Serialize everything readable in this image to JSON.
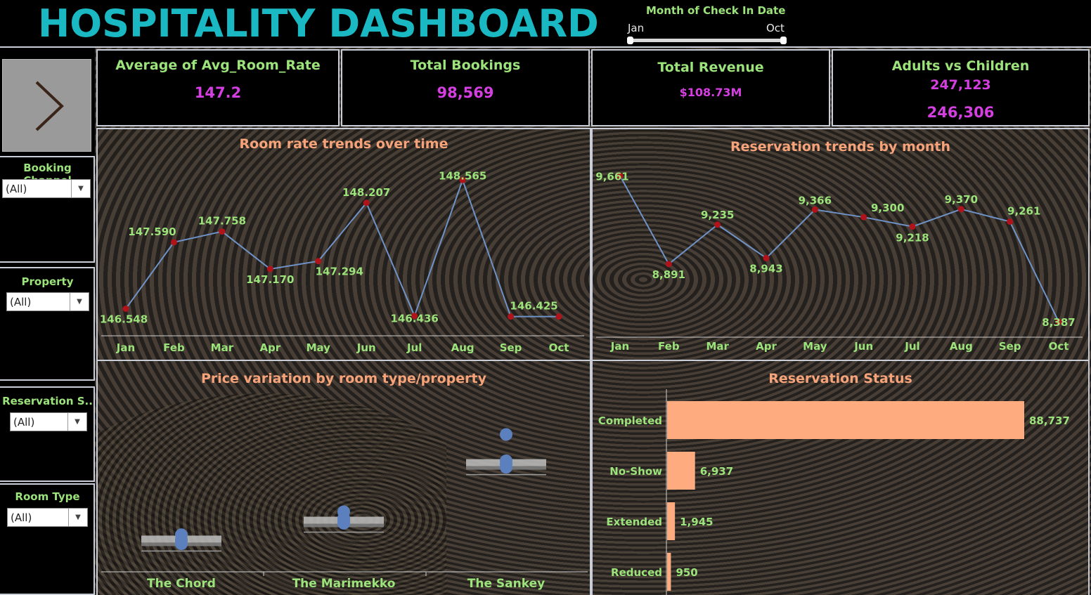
{
  "header": {
    "title": "HOSPITALITY DASHBOARD",
    "filter_label": "Month of Check In Date",
    "filter_min": "Jan",
    "filter_max": "Oct"
  },
  "sidebar": {
    "filters": [
      {
        "label": "Booking Channel",
        "value": "(All)"
      },
      {
        "label": "Property",
        "value": "(All)"
      },
      {
        "label": "Reservation S..",
        "value": "(All)"
      },
      {
        "label": "Room Type",
        "value": "(All)"
      }
    ]
  },
  "kpis": [
    {
      "title": "Average of Avg_Room_Rate",
      "value": "147.2"
    },
    {
      "title": "Total Bookings",
      "value": "98,569"
    },
    {
      "title": "Total Revenue",
      "value": "$108.73M"
    },
    {
      "title": "Adults vs Children",
      "value": "247,123",
      "value2": "246,306"
    }
  ],
  "colors": {
    "line": "#6f93c8",
    "marker": "#b0141a",
    "label": "#9be37a",
    "bar": "#ffab80",
    "title": "#f7a37a",
    "kpi_value": "#d53ee0",
    "header_title": "#19b8c2"
  },
  "chart_data": [
    {
      "type": "line",
      "title": "Room rate trends over time",
      "categories": [
        "Jan",
        "Feb",
        "Mar",
        "Apr",
        "May",
        "Jun",
        "Jul",
        "Aug",
        "Sep",
        "Oct"
      ],
      "values": [
        146.548,
        147.59,
        147.758,
        147.17,
        147.294,
        148.207,
        146.436,
        148.565,
        146.425,
        146.425
      ],
      "labels": [
        "146.548",
        "147.590",
        "147.758",
        "147.170",
        "147.294",
        "148.207",
        "146.436",
        "148.565",
        "146.425",
        ""
      ],
      "ylim": [
        146.3,
        148.7
      ]
    },
    {
      "type": "line",
      "title": "Reservation trends by month",
      "categories": [
        "Jan",
        "Feb",
        "Mar",
        "Apr",
        "May",
        "Jun",
        "Jul",
        "Aug",
        "Sep",
        "Oct"
      ],
      "values": [
        9661,
        8891,
        9235,
        8943,
        9366,
        9300,
        9218,
        9370,
        9261,
        8387
      ],
      "labels": [
        "9,661",
        "8,891",
        "9,235",
        "8,943",
        "9,366",
        "9,300",
        "9,218",
        "9,370",
        "9,261",
        "8,387"
      ],
      "ylim": [
        8350,
        9700
      ]
    },
    {
      "type": "scatter",
      "title": "Price variation by room type/property",
      "categories": [
        "The Chord",
        "The Marimekko",
        "The Sankey"
      ],
      "points": [
        {
          "category": "The Chord",
          "values": [
            128,
            122,
            120,
            117
          ]
        },
        {
          "category": "The Marimekko",
          "values": [
            156,
            148,
            145,
            142
          ]
        },
        {
          "category": "The Sankey",
          "values": [
            250,
            218,
            214,
            210
          ]
        }
      ],
      "medians": [
        121,
        144,
        214
      ]
    },
    {
      "type": "bar",
      "title": "Reservation Status",
      "categories": [
        "Completed",
        "No-Show",
        "Extended",
        "Reduced"
      ],
      "values": [
        88737,
        6937,
        1945,
        950
      ],
      "labels": [
        "88,737",
        "6,937",
        "1,945",
        "950"
      ]
    }
  ]
}
